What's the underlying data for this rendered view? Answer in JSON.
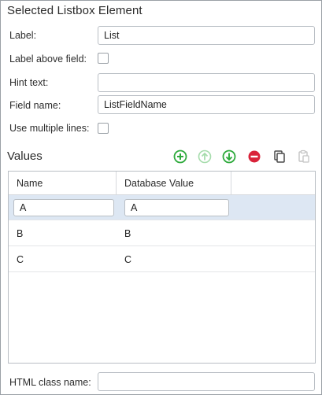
{
  "panel": {
    "title": "Selected Listbox Element"
  },
  "form": {
    "label_caption": "Label:",
    "label_value": "List",
    "label_above_caption": "Label above field:",
    "hint_caption": "Hint text:",
    "hint_value": "",
    "field_name_caption": "Field name:",
    "field_name_value": "ListFieldName",
    "multiple_lines_caption": "Use multiple lines:"
  },
  "values": {
    "title": "Values",
    "toolbar": [
      {
        "name": "add-icon",
        "color": "#2eaa3c",
        "enabled": true
      },
      {
        "name": "move-up-icon",
        "color": "#9fd7a6",
        "enabled": false
      },
      {
        "name": "move-down-icon",
        "color": "#2eaa3c",
        "enabled": true
      },
      {
        "name": "remove-icon",
        "color": "#d9233a",
        "enabled": true
      },
      {
        "name": "copy-icon",
        "color": "#4a4a4a",
        "enabled": true
      },
      {
        "name": "paste-icon",
        "color": "#c4c4c4",
        "enabled": false
      }
    ],
    "columns": [
      "Name",
      "Database Value",
      ""
    ],
    "rows": [
      {
        "name": "A",
        "value": "A"
      },
      {
        "name": "B",
        "value": "B"
      },
      {
        "name": "C",
        "value": "C"
      }
    ]
  },
  "footer": {
    "html_class_caption": "HTML class name:",
    "html_class_value": ""
  }
}
